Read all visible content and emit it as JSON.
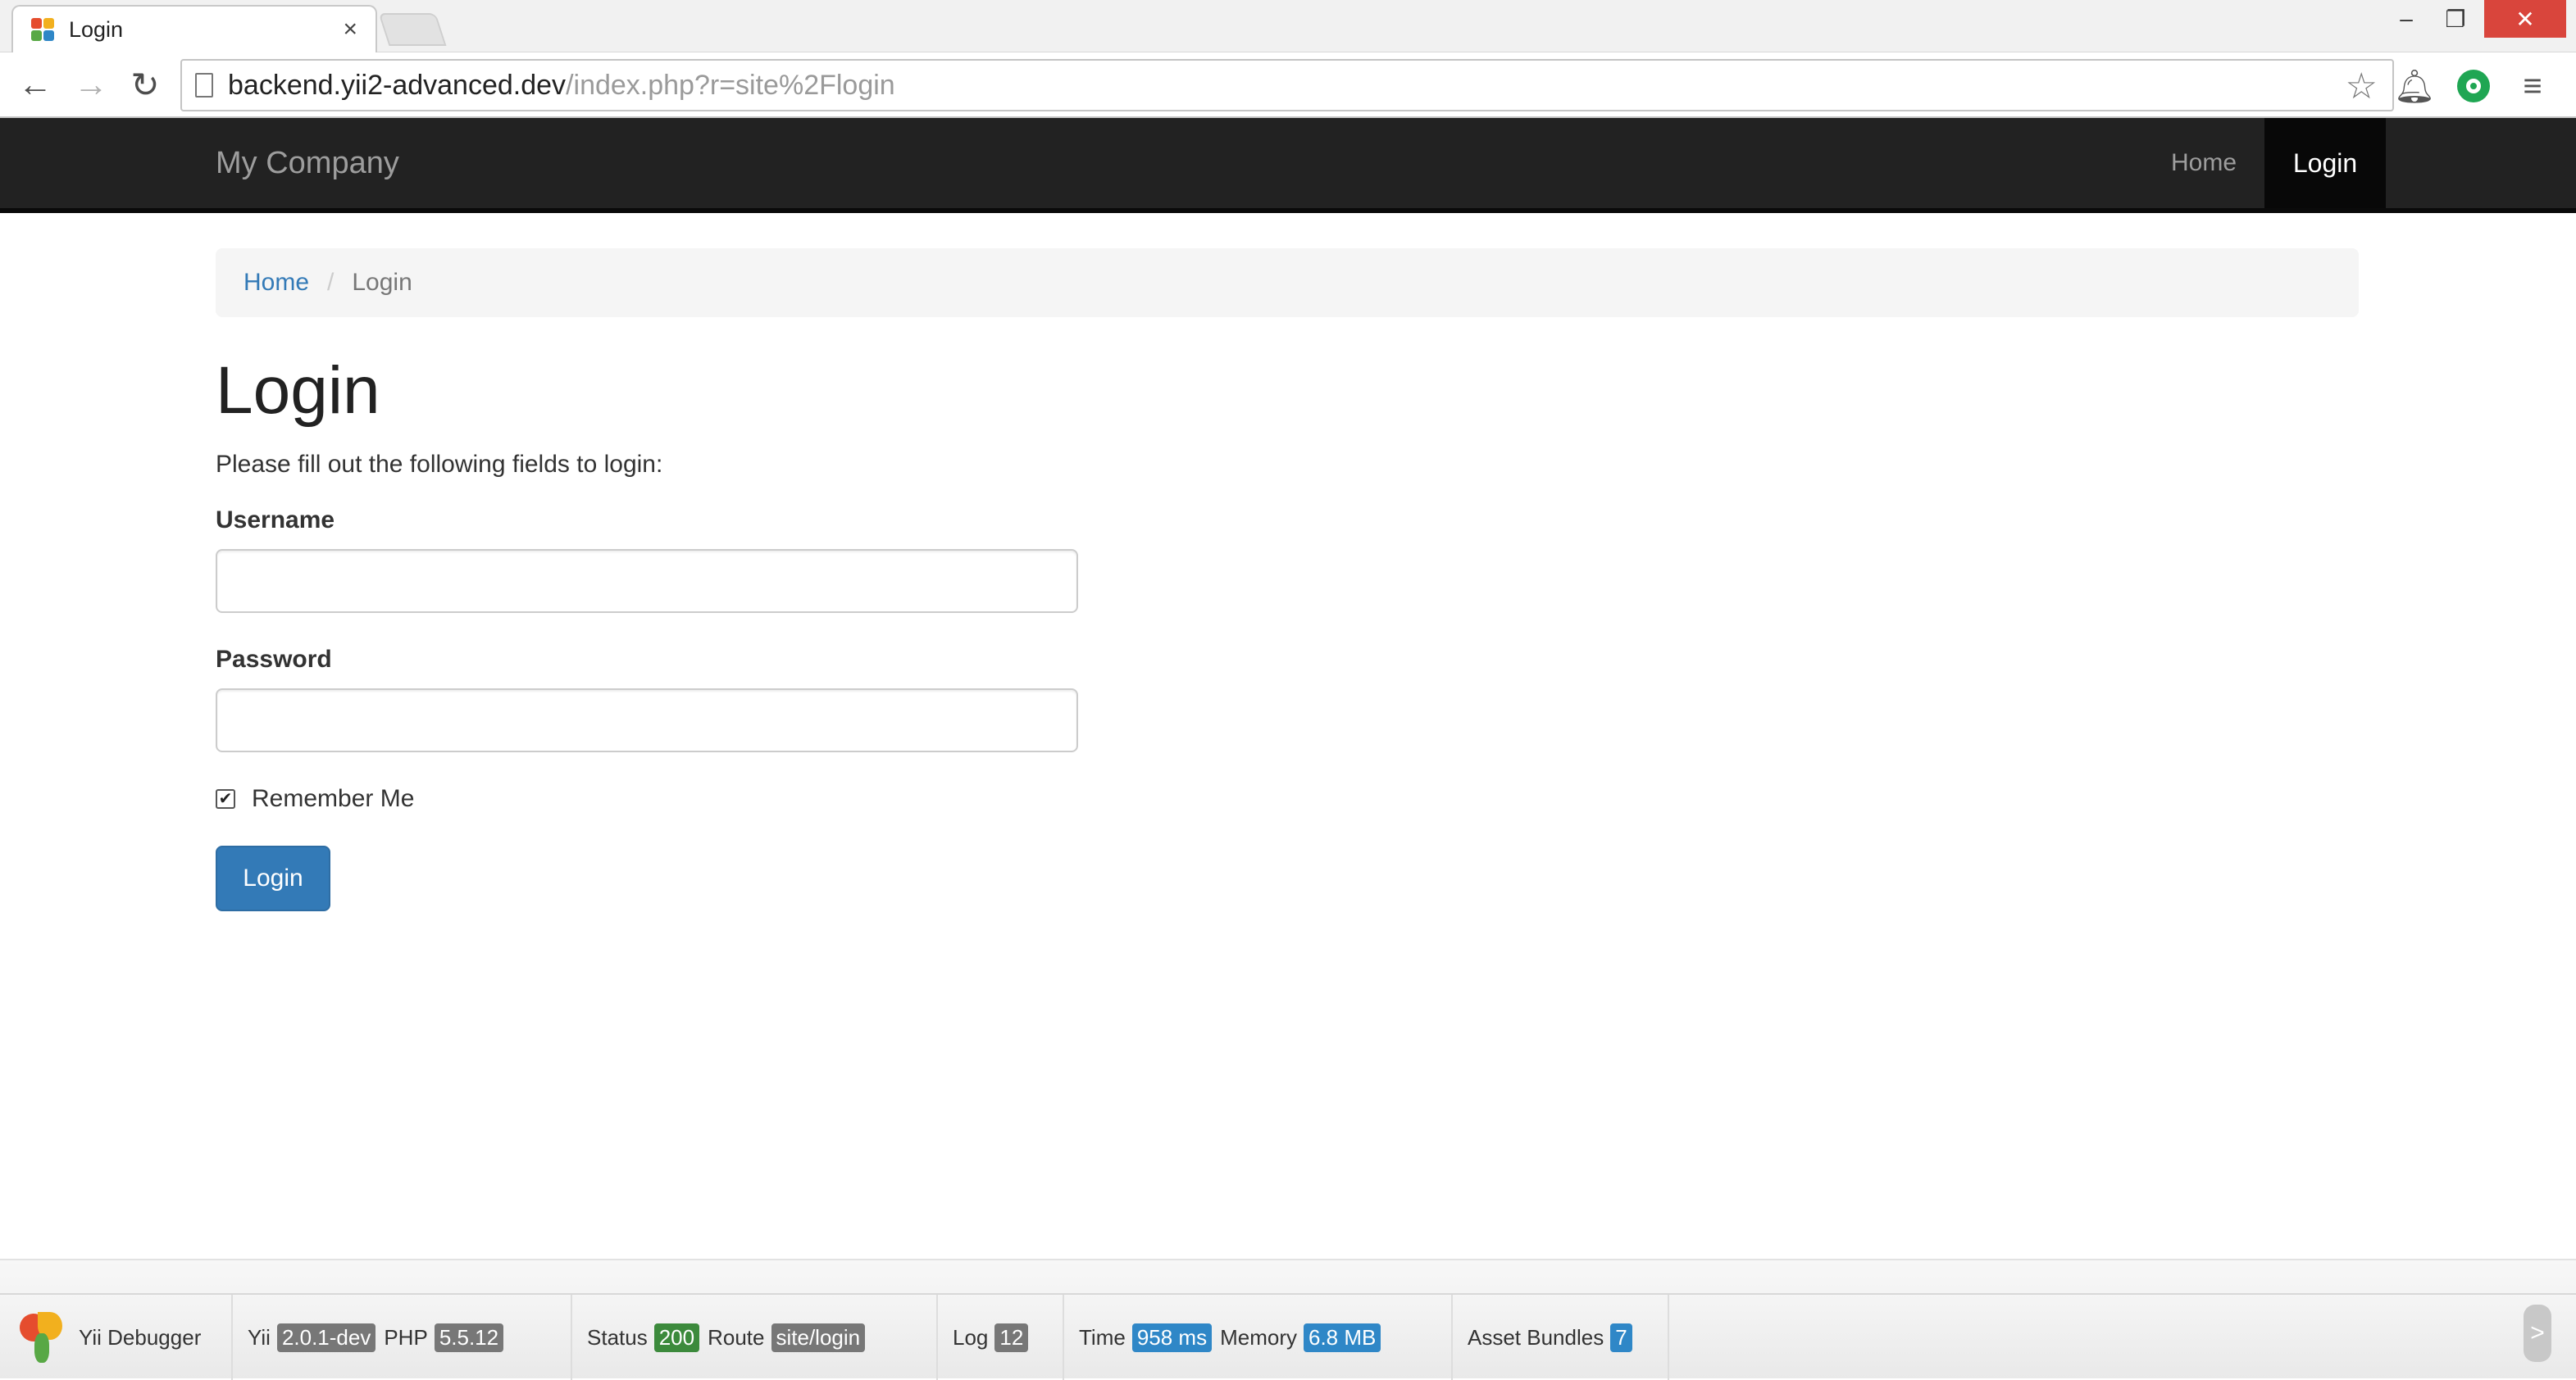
{
  "browser": {
    "tab_title": "Login",
    "tab_close": "×",
    "url_host": "backend.yii2-advanced.dev",
    "url_path": "/index.php?r=site%2Flogin",
    "window_min": "–",
    "window_max": "❐",
    "window_close": "✕",
    "favicon_colors": [
      "#e54d2e",
      "#f2b01e",
      "#58a845",
      "#2f87c7"
    ]
  },
  "navbar": {
    "brand": "My Company",
    "items": [
      {
        "label": "Home",
        "active": false
      },
      {
        "label": "Login",
        "active": true
      }
    ]
  },
  "breadcrumb": {
    "home": "Home",
    "separator": "/",
    "current": "Login"
  },
  "page": {
    "title": "Login",
    "intro": "Please fill out the following fields to login:"
  },
  "form": {
    "username_label": "Username",
    "username_value": "",
    "password_label": "Password",
    "password_value": "",
    "remember_label": "Remember Me",
    "remember_checked": true,
    "submit_label": "Login"
  },
  "debug_toolbar": {
    "name": "Yii Debugger",
    "yii_label": "Yii",
    "yii_version": "2.0.1-dev",
    "php_label": "PHP",
    "php_version": "5.5.12",
    "status_label": "Status",
    "status_value": "200",
    "route_label": "Route",
    "route_value": "site/login",
    "log_label": "Log",
    "log_value": "12",
    "time_label": "Time",
    "time_value": "958 ms",
    "memory_label": "Memory",
    "memory_value": "6.8 MB",
    "assets_label": "Asset Bundles",
    "assets_value": "7",
    "toggle": ">"
  },
  "colors": {
    "navbar_bg": "#222222",
    "primary": "#337ab7",
    "status_ok": "#3c8a3c",
    "debug_badge_blue": "#2f87c7"
  }
}
